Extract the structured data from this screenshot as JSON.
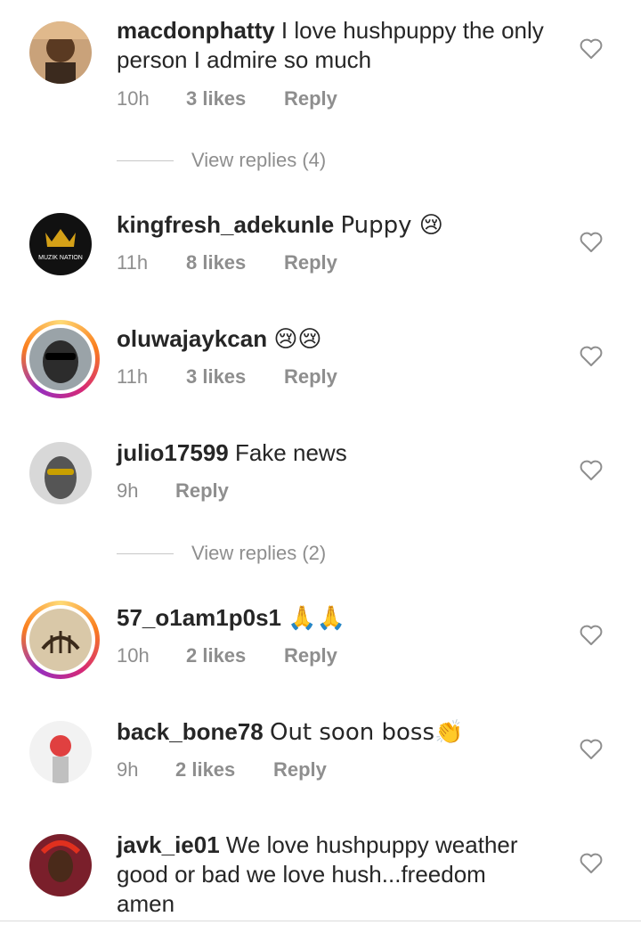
{
  "comments": [
    {
      "username": "macdonphatty",
      "text": "I love hushpuppy the only person I admire so much",
      "time": "10h",
      "likes": "3 likes",
      "reply": "Reply",
      "view_replies": "View replies (4)"
    },
    {
      "username": "kingfresh_adekunle",
      "text": "Puppy 😢",
      "time": "11h",
      "likes": "8 likes",
      "reply": "Reply",
      "avatar_text": "MUZIK NATION"
    },
    {
      "username": "oluwajaykcan",
      "text": "😢😢",
      "time": "11h",
      "likes": "3 likes",
      "reply": "Reply"
    },
    {
      "username": "julio17599",
      "text": "Fake news",
      "time": "9h",
      "reply": "Reply",
      "view_replies": "View replies (2)"
    },
    {
      "username": "57_o1am1p0s1",
      "text": "🙏🙏",
      "time": "10h",
      "likes": "2 likes",
      "reply": "Reply"
    },
    {
      "username": "back_bone78",
      "text": "Out soon boss👏",
      "time": "9h",
      "likes": "2 likes",
      "reply": "Reply"
    },
    {
      "username": "javk_ie01",
      "text": "We love hushpuppy weather good or bad we love hush...freedom amen"
    }
  ],
  "icons": {
    "like": "heart-outline-icon"
  },
  "colors": {
    "meta": "#8e8e8e",
    "text": "#262626",
    "story_ring": "#d62976"
  }
}
